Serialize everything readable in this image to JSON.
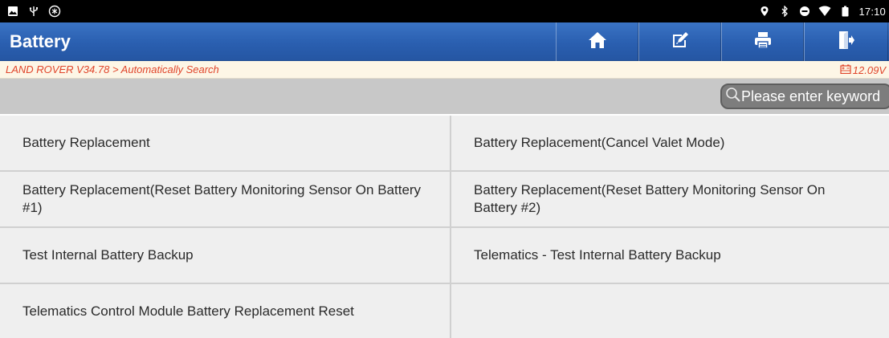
{
  "status_bar": {
    "left_icons": [
      "gallery-icon",
      "usb-icon",
      "settings-badge-icon"
    ],
    "right_icons": [
      "location-icon",
      "bluetooth-icon",
      "do-not-disturb-icon",
      "wifi-icon",
      "battery-icon"
    ],
    "time": "17:10"
  },
  "header": {
    "title": "Battery",
    "buttons": [
      {
        "name": "home-button",
        "icon": "home-icon"
      },
      {
        "name": "edit-button",
        "icon": "edit-icon"
      },
      {
        "name": "print-button",
        "icon": "printer-icon"
      },
      {
        "name": "exit-button",
        "icon": "exit-icon"
      }
    ]
  },
  "breadcrumb": {
    "path": "LAND ROVER V34.78 > Automatically Search",
    "voltage": "12.09V"
  },
  "search": {
    "placeholder": "Please enter keyword",
    "value": ""
  },
  "functions": [
    "Battery Replacement",
    "Battery Replacement(Cancel Valet Mode)",
    "Battery Replacement(Reset Battery Monitoring Sensor On Battery #1)",
    "Battery Replacement(Reset Battery Monitoring Sensor On Battery #2)",
    "Test Internal Battery Backup",
    "Telematics - Test Internal Battery Backup",
    "Telematics Control Module Battery Replacement Reset"
  ],
  "colors": {
    "header_blue": "#2a5fb0",
    "breadcrumb_text": "#e0452b",
    "search_strip": "#c8c8c8",
    "cell_background": "#efefef"
  }
}
